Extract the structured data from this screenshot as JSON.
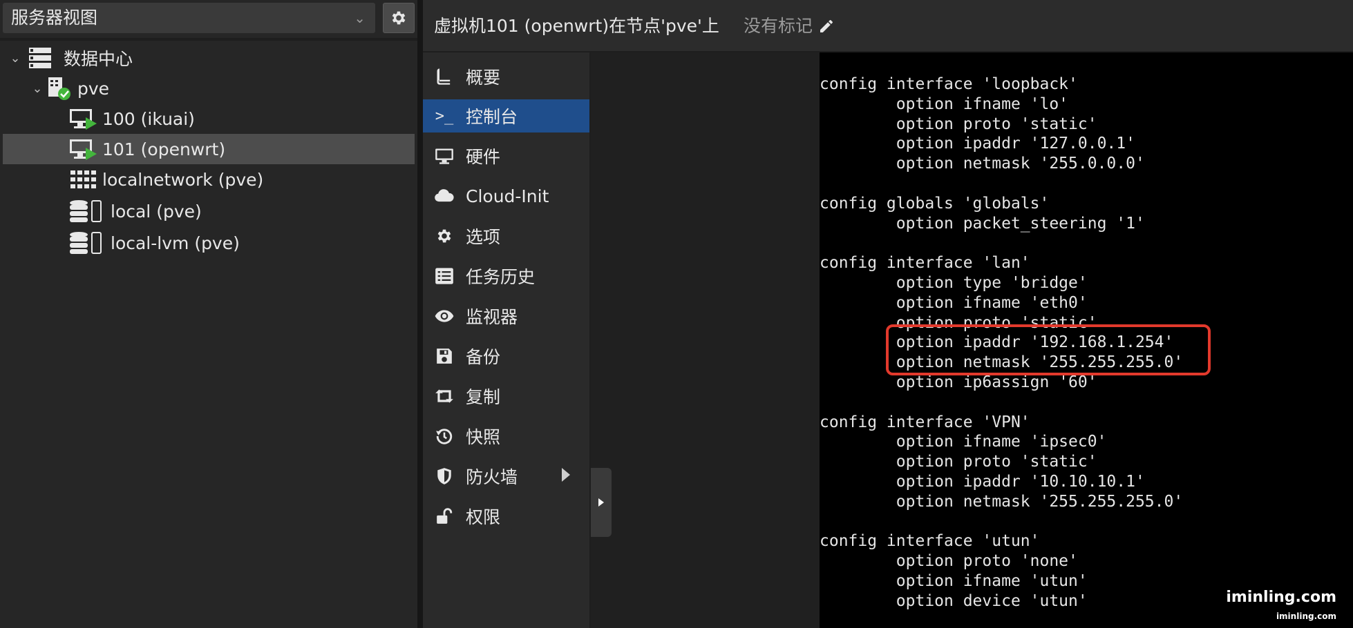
{
  "tree": {
    "view_label": "服务器视图",
    "items": [
      {
        "label": "数据中心"
      },
      {
        "label": "pve"
      },
      {
        "label": "100 (ikuai)"
      },
      {
        "label": "101 (openwrt)"
      },
      {
        "label": "localnetwork (pve)"
      },
      {
        "label": "local (pve)"
      },
      {
        "label": "local-lvm (pve)"
      }
    ]
  },
  "header": {
    "title": "虚拟机101 (openwrt)在节点'pve'上",
    "tags_placeholder": "没有标记"
  },
  "nav": {
    "items": [
      {
        "label": "概要"
      },
      {
        "label": "控制台"
      },
      {
        "label": "硬件"
      },
      {
        "label": "Cloud-Init"
      },
      {
        "label": "选项"
      },
      {
        "label": "任务历史"
      },
      {
        "label": "监视器"
      },
      {
        "label": "备份"
      },
      {
        "label": "复制"
      },
      {
        "label": "快照"
      },
      {
        "label": "防火墙"
      },
      {
        "label": "权限"
      }
    ]
  },
  "console": {
    "lines": [
      "config interface 'loopback'",
      "        option ifname 'lo'",
      "        option proto 'static'",
      "        option ipaddr '127.0.0.1'",
      "        option netmask '255.0.0.0'",
      "",
      "config globals 'globals'",
      "        option packet_steering '1'",
      "",
      "config interface 'lan'",
      "        option type 'bridge'",
      "        option ifname 'eth0'",
      "        option proto 'static'",
      "        option ipaddr '192.168.1.254'",
      "        option netmask '255.255.255.0'",
      "        option ip6assign '60'",
      "",
      "config interface 'VPN'",
      "        option ifname 'ipsec0'",
      "        option proto 'static'",
      "        option ipaddr '10.10.10.1'",
      "        option netmask '255.255.255.0'",
      "",
      "config interface 'utun'",
      "        option proto 'none'",
      "        option ifname 'utun'",
      "        option device 'utun'"
    ]
  },
  "watermark": {
    "main": "iminling.com",
    "sub": "iminling.com"
  },
  "colors": {
    "accent": "#1f4e8c",
    "running_green": "#43b53c",
    "highlight_red": "#e2392c"
  }
}
